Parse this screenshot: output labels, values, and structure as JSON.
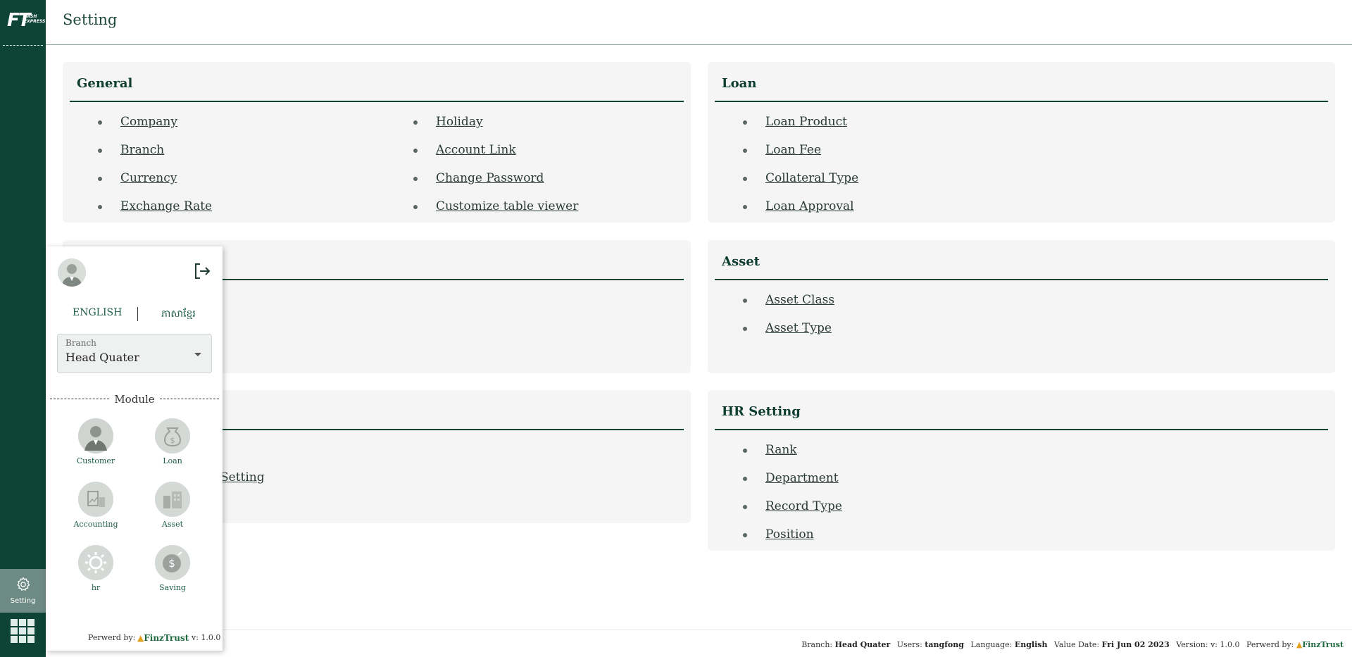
{
  "app": {
    "logo_main": "FT",
    "logo_sub": "CASH EXPRESS"
  },
  "header": {
    "title": "Setting"
  },
  "rail": {
    "setting_label": "Setting"
  },
  "cards": {
    "general": {
      "title": "General",
      "col1": [
        "Company",
        "Branch",
        "Currency",
        "Exchange Rate"
      ],
      "col2": [
        "Holiday",
        "Account Link",
        "Change Password",
        "Customize table viewer"
      ]
    },
    "loan": {
      "title": "Loan",
      "items": [
        "Loan Product",
        "Loan Fee",
        "Collateral Type",
        "Loan Approval"
      ]
    },
    "asset": {
      "title": "Asset",
      "items": [
        "Asset Class",
        "Asset Type"
      ]
    },
    "hr": {
      "title": "HR Setting",
      "items": [
        "Rank",
        "Department",
        "Record Type",
        "Position"
      ]
    },
    "hidden_partial": {
      "visible_text": "Setting"
    }
  },
  "popup": {
    "lang_en": "ENGLISH",
    "lang_kh": "ភាសាខ្មែរ",
    "branch_label": "Branch",
    "branch_value": "Head Quater",
    "module_title": "Module",
    "modules": [
      {
        "label": "Customer",
        "icon": "customer-icon"
      },
      {
        "label": "Loan",
        "icon": "loan-icon"
      },
      {
        "label": "Accounting",
        "icon": "accounting-icon"
      },
      {
        "label": "Asset",
        "icon": "asset-icon"
      },
      {
        "label": "hr",
        "icon": "hr-icon"
      },
      {
        "label": "Saving",
        "icon": "saving-icon"
      }
    ],
    "powered_by": "Perwerd by:",
    "brand": "FinzTrust",
    "version": "v: 1.0.0"
  },
  "footer": {
    "branch_label": "Branch:",
    "branch_value": "Head Quater",
    "users_label": "Users:",
    "users_value": "tangfong",
    "language_label": "Language:",
    "language_value": "English",
    "value_date_label": "Value Date:",
    "value_date_value": "Fri Jun 02 2023",
    "version_label": "Version:",
    "version_value": "v: 1.0.0",
    "powered_by": "Perwerd by:",
    "brand": "FinzTrust"
  }
}
